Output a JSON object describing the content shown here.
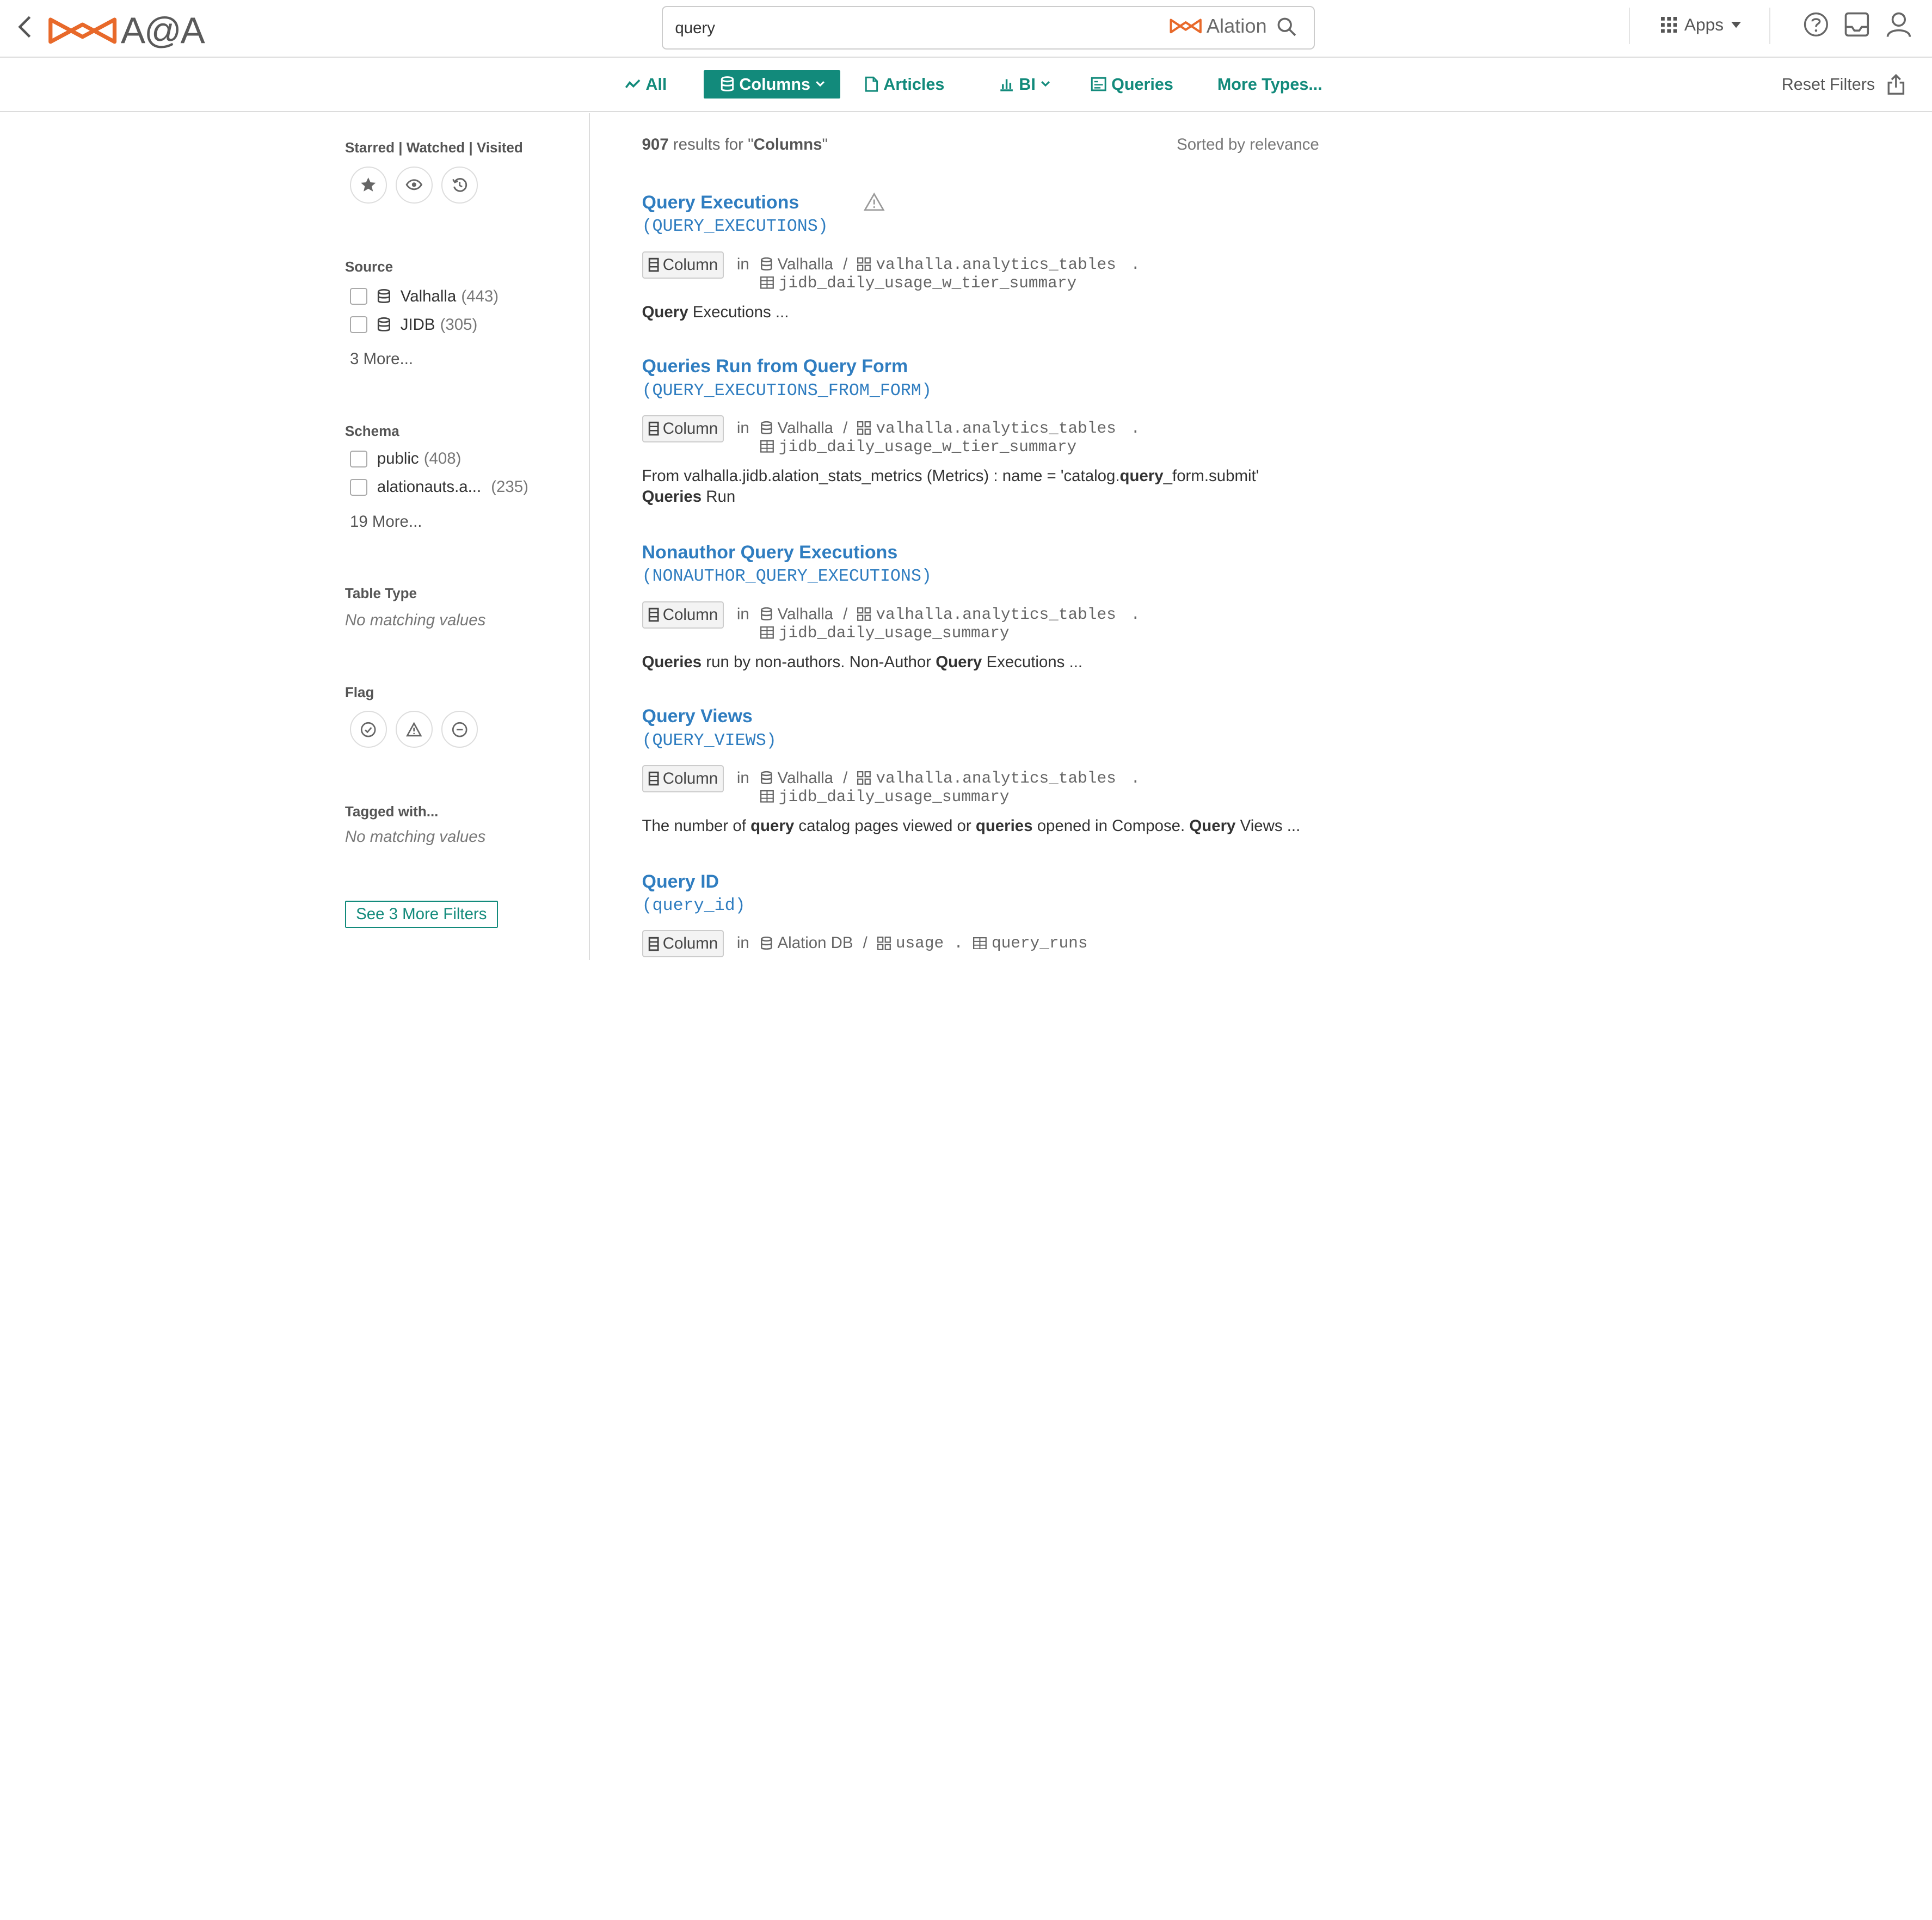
{
  "header": {
    "logo_text": "A@A",
    "search_value": "query",
    "search_brand": "Alation",
    "apps_label": "Apps"
  },
  "tabs": [
    {
      "label": "All",
      "icon": "trend-icon"
    },
    {
      "label": "Columns",
      "icon": "database-icon",
      "active": true,
      "dropdown": true
    },
    {
      "label": "Articles",
      "icon": "article-icon"
    },
    {
      "label": "BI",
      "icon": "bar-chart-icon",
      "dropdown": true
    },
    {
      "label": "Queries",
      "icon": "query-icon"
    },
    {
      "label": "More Types..."
    }
  ],
  "toolbar": {
    "reset_label": "Reset Filters"
  },
  "sidebar": {
    "starred_title": "Starred | Watched | Visited",
    "source": {
      "title": "Source",
      "items": [
        {
          "label": "Valhalla",
          "count": "(443)"
        },
        {
          "label": "JIDB",
          "count": "(305)"
        }
      ],
      "more": "3 More..."
    },
    "schema": {
      "title": "Schema",
      "items": [
        {
          "label": "public",
          "count": "(408)"
        },
        {
          "label": "alationauts.a...",
          "count": "(235)"
        }
      ],
      "more": "19 More..."
    },
    "table_type": {
      "title": "Table Type",
      "empty": "No matching values"
    },
    "flag": {
      "title": "Flag"
    },
    "tagged": {
      "title": "Tagged with...",
      "empty": "No matching values"
    },
    "see_more": "See 3 More Filters"
  },
  "results": {
    "count": "907",
    "summary_mid": " results for \"",
    "query_term": "Columns",
    "summary_end": "\"",
    "sorted_label": "Sorted by relevance",
    "badge_label": "Column",
    "in_label": "in",
    "items": [
      {
        "title": "Query Executions",
        "subtitle": "(QUERY_EXECUTIONS)",
        "source": "Valhalla",
        "schema": "valhalla.analytics_tables",
        "table": "jidb_daily_usage_w_tier_summary",
        "desc_parts": [
          {
            "b": "Query"
          },
          {
            "t": " Executions "
          },
          {
            "t": "  ..."
          }
        ]
      },
      {
        "title": "Queries Run from Query Form",
        "subtitle": "(QUERY_EXECUTIONS_FROM_FORM)",
        "source": "Valhalla",
        "schema": "valhalla.analytics_tables",
        "table": "jidb_daily_usage_w_tier_summary",
        "desc_line1": "From valhalla.jidb.alation_stats_metrics (Metrics) : name = 'catalog.",
        "desc_line1_bold": "query",
        "desc_line1_end": "_form.submit'",
        "desc_line2_bold": "Queries",
        "desc_line2_end": " Run"
      },
      {
        "title": "Nonauthor Query Executions",
        "subtitle": "(NONAUTHOR_QUERY_EXECUTIONS)",
        "source": "Valhalla",
        "schema": "valhalla.analytics_tables",
        "table": "jidb_daily_usage_summary",
        "desc_b1": "Queries",
        "desc_t1": " run by non-authors. Non-Author ",
        "desc_b2": "Query",
        "desc_t2": " Executions ",
        "desc_ellipsis": "  ..."
      },
      {
        "title": "Query Views",
        "subtitle": "(QUERY_VIEWS)",
        "source": "Valhalla",
        "schema": "valhalla.analytics_tables",
        "table": "jidb_daily_usage_summary",
        "desc_t1": "The number of ",
        "desc_b1": "query",
        "desc_t2": " catalog pages viewed or ",
        "desc_b2": "queries",
        "desc_t3": " opened in Compose. ",
        "desc_b3": "Query",
        "desc_t4": " Views ",
        "desc_ellipsis": "  ..."
      },
      {
        "title": "Query ID",
        "subtitle": "(query_id)",
        "source": "Alation DB",
        "schema": "usage",
        "table": "query_runs"
      }
    ]
  },
  "colors": {
    "accent": "#128a7b",
    "link": "#2f7dc0",
    "logo_orange": "#e8692a"
  }
}
